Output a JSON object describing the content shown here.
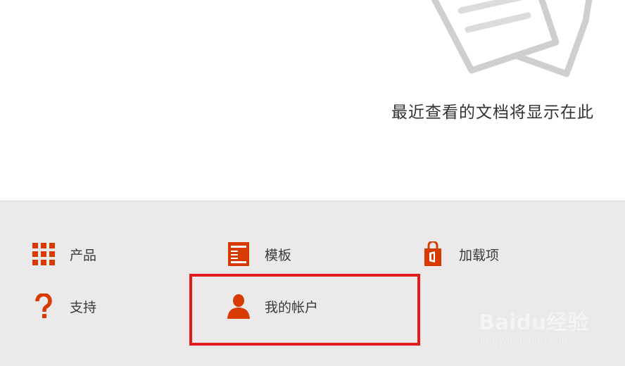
{
  "recent": {
    "empty_message": "最近查看的文档将显示在此"
  },
  "footer": {
    "tiles": [
      {
        "label": "产品",
        "icon": "grid-icon"
      },
      {
        "label": "模板",
        "icon": "template-icon"
      },
      {
        "label": "加载项",
        "icon": "store-bag-icon"
      },
      {
        "label": "支持",
        "icon": "question-icon"
      },
      {
        "label": "我的帐户",
        "icon": "person-icon"
      }
    ]
  },
  "watermark": {
    "brand": "Baidu经验",
    "url": "jingyan.baidu.com"
  },
  "colors": {
    "accent": "#d83b01",
    "panel": "#ebe9ea",
    "highlight": "#e21a1a"
  }
}
